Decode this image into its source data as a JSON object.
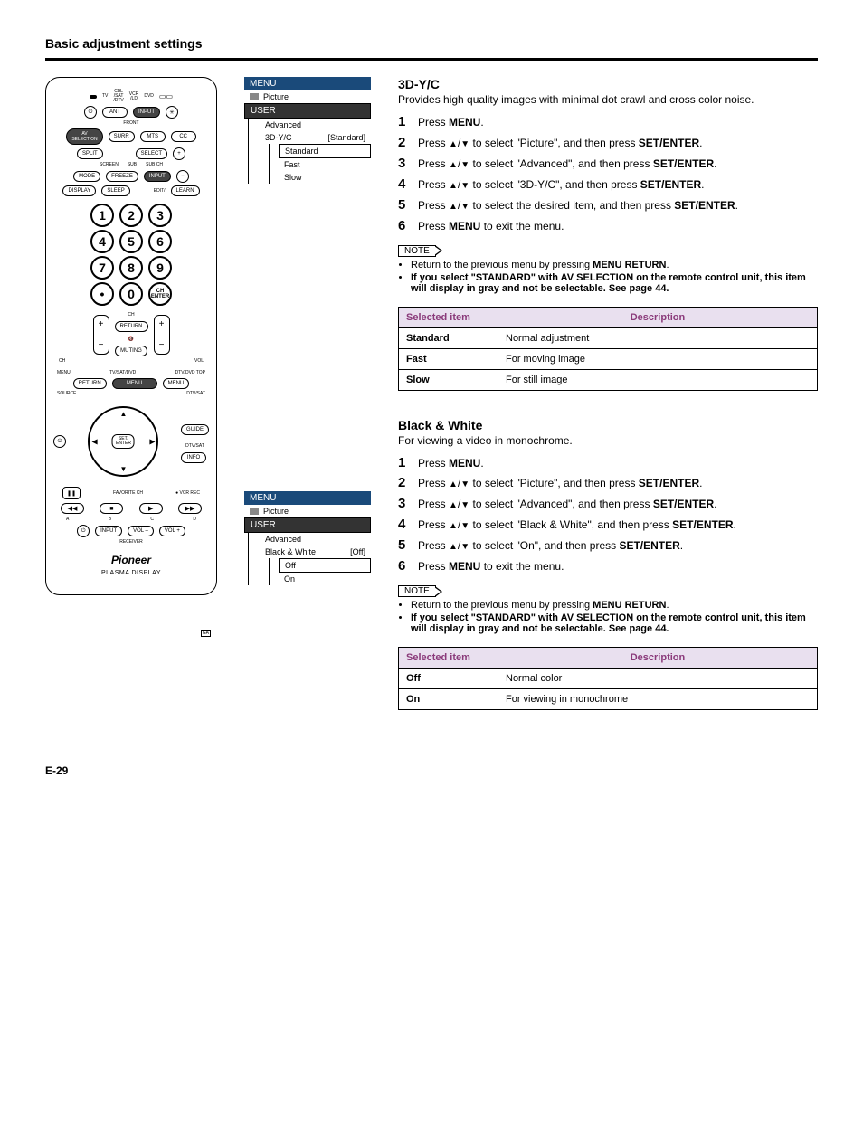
{
  "page_title": "Basic adjustment settings",
  "page_number": "E-29",
  "remote": {
    "top_labels": {
      "tv": "TV",
      "cbl": "CBL\n/SAT\n/DTV",
      "vcr": "VCR\n/LD",
      "dvd": "DVD"
    },
    "row2": {
      "ant": "ANT",
      "input": "INPUT"
    },
    "front_label": "FRONT",
    "row3": {
      "av": "AV\nSELECTION",
      "surr": "SURR",
      "mts": "MTS",
      "cc": "CC"
    },
    "row4": {
      "split": "SPLIT",
      "select": "SELECT"
    },
    "row4_labels": {
      "screen": "SCREEN",
      "sub": "SUB",
      "subch": "SUB CH"
    },
    "row5": {
      "mode": "MODE",
      "freeze": "FREEZE",
      "input2": "INPUT"
    },
    "row6": {
      "display": "DISPLAY",
      "sleep": "SLEEP",
      "edit": "EDIT/",
      "learn": "LEARN"
    },
    "digits": [
      "1",
      "2",
      "3",
      "4",
      "5",
      "6",
      "7",
      "8",
      "9",
      "•",
      "0"
    ],
    "ch_enter": "CH\nENTER",
    "volch": {
      "ch": "CH",
      "return": "RETURN",
      "mute_icon": "🔇",
      "muting": "MUTING",
      "vol": "VOL"
    },
    "menus": {
      "menu_l": "MENU",
      "tvsat": "TV/SAT/DVD",
      "dvdtop": "DTV/DVD TOP",
      "return": "RETURN",
      "menu_c": "MENU",
      "menu_r": "MENU",
      "source": "SOURCE",
      "dtvsat": "DTV/SAT",
      "guide": "GUIDE",
      "setenter": "SET/\nENTER",
      "dtvsat2": "DTV/SAT",
      "info": "INFO",
      "favorite": "FAVORITE CH",
      "vcrrec": "VCR REC"
    },
    "transportLabels": [
      "A",
      "B",
      "C",
      "D"
    ],
    "bottom": {
      "input": "INPUT",
      "volminus": "VOL –",
      "volplus": "VOL +",
      "receiver": "RECEIVER"
    },
    "logo": "Pioneer",
    "sublogo": "PLASMA DISPLAY",
    "corner": "GA"
  },
  "osd1": {
    "title": "MENU",
    "picture": "Picture",
    "user": "USER",
    "advanced": "Advanced",
    "setting": "3D-Y/C",
    "value": "[Standard]",
    "options": [
      "Standard",
      "Fast",
      "Slow"
    ]
  },
  "osd2": {
    "title": "MENU",
    "picture": "Picture",
    "user": "USER",
    "advanced": "Advanced",
    "setting": "Black & White",
    "value": "[Off]",
    "options": [
      "Off",
      "On"
    ]
  },
  "section1": {
    "title": "3D-Y/C",
    "desc": "Provides high quality images with minimal dot crawl and cross color noise.",
    "steps": [
      {
        "pre": "Press ",
        "b": "MENU",
        "post": "."
      },
      {
        "pre": "Press ",
        "keys": "up/down",
        "mid": " to select \"Picture\", and then press ",
        "b": "SET/ENTER",
        "post": "."
      },
      {
        "pre": "Press ",
        "keys": "up/down",
        "mid": " to select \"Advanced\", and then press ",
        "b": "SET/ENTER",
        "post": "."
      },
      {
        "pre": "Press ",
        "keys": "up/down",
        "mid": " to select \"3D-Y/C\", and then press ",
        "b": "SET/ENTER",
        "post": "."
      },
      {
        "pre": "Press ",
        "keys": "up/down",
        "mid": " to select the desired item, and then press ",
        "b": "SET/ENTER",
        "post": "."
      },
      {
        "pre": "Press ",
        "b": "MENU",
        "post": " to exit the menu."
      }
    ],
    "note_label": "NOTE",
    "notes": [
      {
        "text": "Return to the previous menu by pressing ",
        "b": "MENU RETURN",
        "post": "."
      },
      {
        "bold_all": "If you select \"STANDARD\" with AV SELECTION on the remote control unit, this item will display in gray and not be selectable. See page 44."
      }
    ],
    "table": {
      "h1": "Selected item",
      "h2": "Description",
      "rows": [
        {
          "k": "Standard",
          "v": "Normal adjustment"
        },
        {
          "k": "Fast",
          "v": "For moving image"
        },
        {
          "k": "Slow",
          "v": "For still image"
        }
      ]
    }
  },
  "section2": {
    "title": "Black & White",
    "desc": "For viewing a video in monochrome.",
    "steps": [
      {
        "pre": "Press ",
        "b": "MENU",
        "post": "."
      },
      {
        "pre": "Press ",
        "keys": "up/down",
        "mid": " to select \"Picture\", and then press ",
        "b": "SET/ENTER",
        "post": "."
      },
      {
        "pre": "Press ",
        "keys": "up/down",
        "mid": " to select \"Advanced\", and then press ",
        "b": "SET/ENTER",
        "post": "."
      },
      {
        "pre": "Press ",
        "keys": "up/down",
        "mid": " to select \"Black & White\", and then press ",
        "b": "SET/ENTER",
        "post": "."
      },
      {
        "pre": "Press ",
        "keys": "up/down",
        "mid": " to select \"On\", and then press ",
        "b": "SET/ENTER",
        "post": "."
      },
      {
        "pre": "Press ",
        "b": "MENU",
        "post": " to exit the menu."
      }
    ],
    "note_label": "NOTE",
    "notes": [
      {
        "text": "Return to the previous menu by pressing ",
        "b": "MENU RETURN",
        "post": "."
      },
      {
        "bold_all": "If you select \"STANDARD\" with AV SELECTION on the remote control unit, this item will display in gray and not be selectable. See page 44."
      }
    ],
    "table": {
      "h1": "Selected item",
      "h2": "Description",
      "rows": [
        {
          "k": "Off",
          "v": "Normal color"
        },
        {
          "k": "On",
          "v": "For viewing in monochrome"
        }
      ]
    }
  }
}
